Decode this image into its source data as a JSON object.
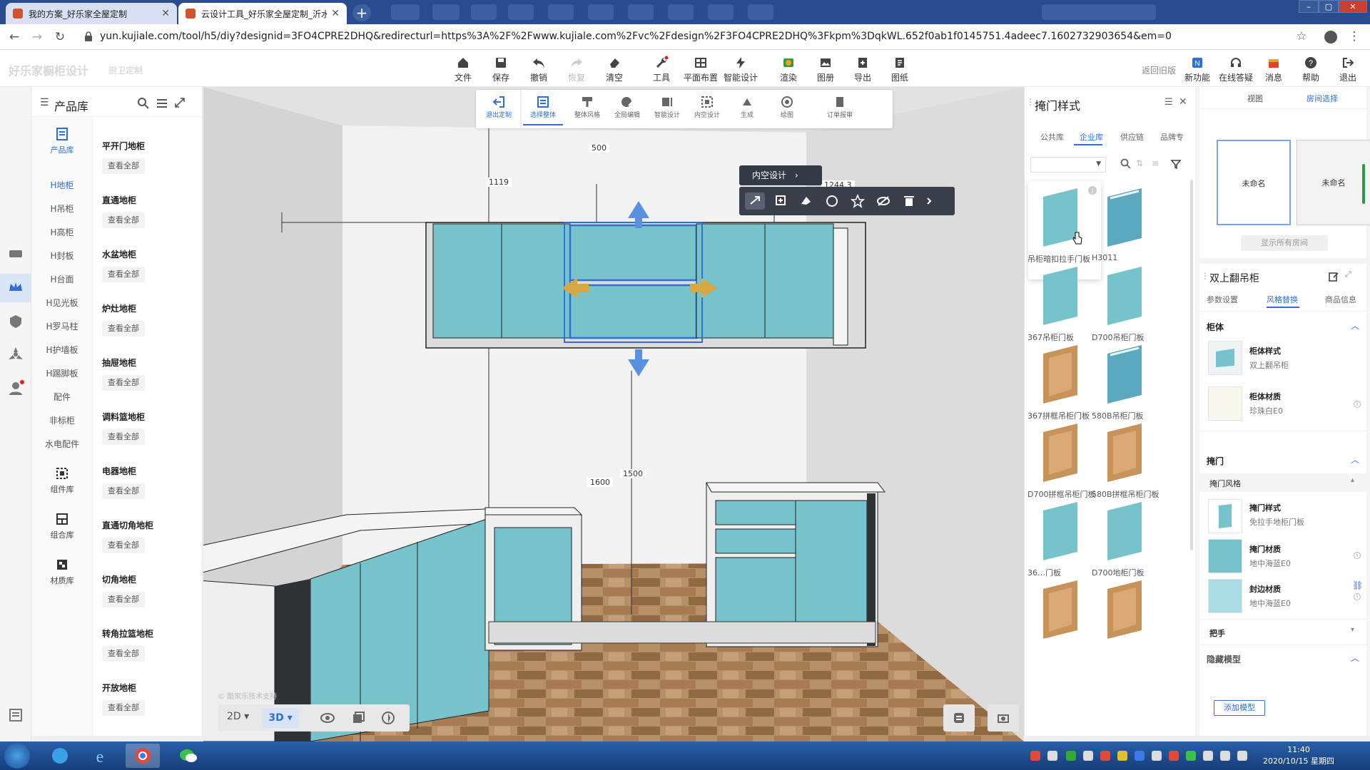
{
  "browser": {
    "tabs": [
      {
        "title": "我的方案_好乐家全屋定制"
      },
      {
        "title": "云设计工具_好乐家全屋定制_沂水"
      }
    ],
    "url": "yun.kujiale.com/tool/h5/diy?designid=3FO4CPRE2DHQ&redirecturl=https%3A%2F%2Fwww.kujiale.com%2Fvc%2Fdesign%2F3FO4CPRE2DHQ%3Fkpm%3DqkWL.652f0ab1f0145751.4adeec7.1602732903654&em=0"
  },
  "appbar": {
    "brand": "好乐家橱柜设计",
    "brand_sub": "厨卫定制",
    "tools": [
      "文件",
      "保存",
      "撤销",
      "恢复",
      "清空",
      "工具",
      "平面布置",
      "智能设计",
      "渲染",
      "图册",
      "导出",
      "图纸"
    ],
    "right_tools": [
      "新功能",
      "在线答疑",
      "消息",
      "帮助",
      "退出"
    ],
    "old_version": "返回旧版"
  },
  "subtoolbar": {
    "items": [
      "退出定制",
      "选择整体",
      "整体风格",
      "全局编辑",
      "智能设计",
      "内空设计",
      "生成",
      "绘图",
      "订单报审"
    ]
  },
  "floating": {
    "inner_design": "内空设计"
  },
  "dimensions": {
    "d500": "500",
    "d1119": "1119",
    "d1244": "1244.3",
    "d1500": "1500",
    "d1600": "1600"
  },
  "product_library": {
    "title": "产品库",
    "nav": {
      "product_lib": "产品库",
      "categories": [
        "H地柜",
        "H吊柜",
        "H高柜",
        "H封板",
        "H台面",
        "H见光板",
        "H罗马柱",
        "H护墙板",
        "H踢脚板",
        "配件",
        "非标柜",
        "水电配件"
      ],
      "component_lib": "组件库",
      "combo_lib": "组合库",
      "material_lib": "材质库"
    },
    "sections": [
      "平开门地柜",
      "直通地柜",
      "水盆地柜",
      "炉灶地柜",
      "抽屉地柜",
      "调料篮地柜",
      "电器地柜",
      "直通切角地柜",
      "切角地柜",
      "转角拉篮地柜",
      "开放地柜"
    ],
    "view_all": "查看全部"
  },
  "viewport_controls": {
    "mode_2d": "2D",
    "mode_3d": "3D",
    "watermark": "© 酷家乐技术支持"
  },
  "door_panel": {
    "title": "掩门样式",
    "tabs": [
      "公共库",
      "企业库",
      "供应链",
      "品牌专"
    ],
    "swatches": [
      {
        "label": "吊柜暗扣拉手门板",
        "tone": "blue"
      },
      {
        "label": "H3011",
        "tone": "blue-handle"
      },
      {
        "label": "367吊柜门板",
        "tone": "blue"
      },
      {
        "label": "D700吊柜门板",
        "tone": "blue"
      },
      {
        "label": "367拼框吊柜门板",
        "tone": "wood"
      },
      {
        "label": "580B吊柜门板",
        "tone": "blue-handle"
      },
      {
        "label": "D700拼框吊柜门板",
        "tone": "wood"
      },
      {
        "label": "580B拼框吊柜门板",
        "tone": "wood"
      },
      {
        "label": "36…门板",
        "tone": "blue"
      },
      {
        "label": "D700地柜门板",
        "tone": "blue"
      },
      {
        "label": "",
        "tone": "wood"
      },
      {
        "label": "",
        "tone": "wood"
      }
    ]
  },
  "property_panel": {
    "tabs": [
      "视图",
      "房间选择"
    ],
    "rooms": [
      "未命名",
      "未命名"
    ],
    "show_all_rooms": "显示所有房间",
    "cabinet_title": "双上翻吊柜",
    "cabinet_tabs": [
      "参数设置",
      "风格替换",
      "商品信息"
    ],
    "section_body": "柜体",
    "body_style_label": "柜体样式",
    "body_style_value": "双上翻吊柜",
    "body_material_label": "柜体材质",
    "body_material_value": "珍珠白E0",
    "section_door": "掩门",
    "door_style_group": "掩门风格",
    "door_style_label": "掩门样式",
    "door_style_value": "免拉手地柜门板",
    "door_material_label": "掩门材质",
    "door_material_value": "地中海蓝E0",
    "edge_material_label": "封边材质",
    "edge_material_value": "地中海蓝E0",
    "handle": "把手",
    "hidden_model": "隐藏模型",
    "add_model": "添加模型"
  },
  "taskbar": {
    "time": "11:40",
    "date": "2020/10/15 星期四"
  },
  "colors": {
    "cabinet_blue": "#76c3cb",
    "accent": "#2f6fd6",
    "wood": "#c8935a"
  }
}
